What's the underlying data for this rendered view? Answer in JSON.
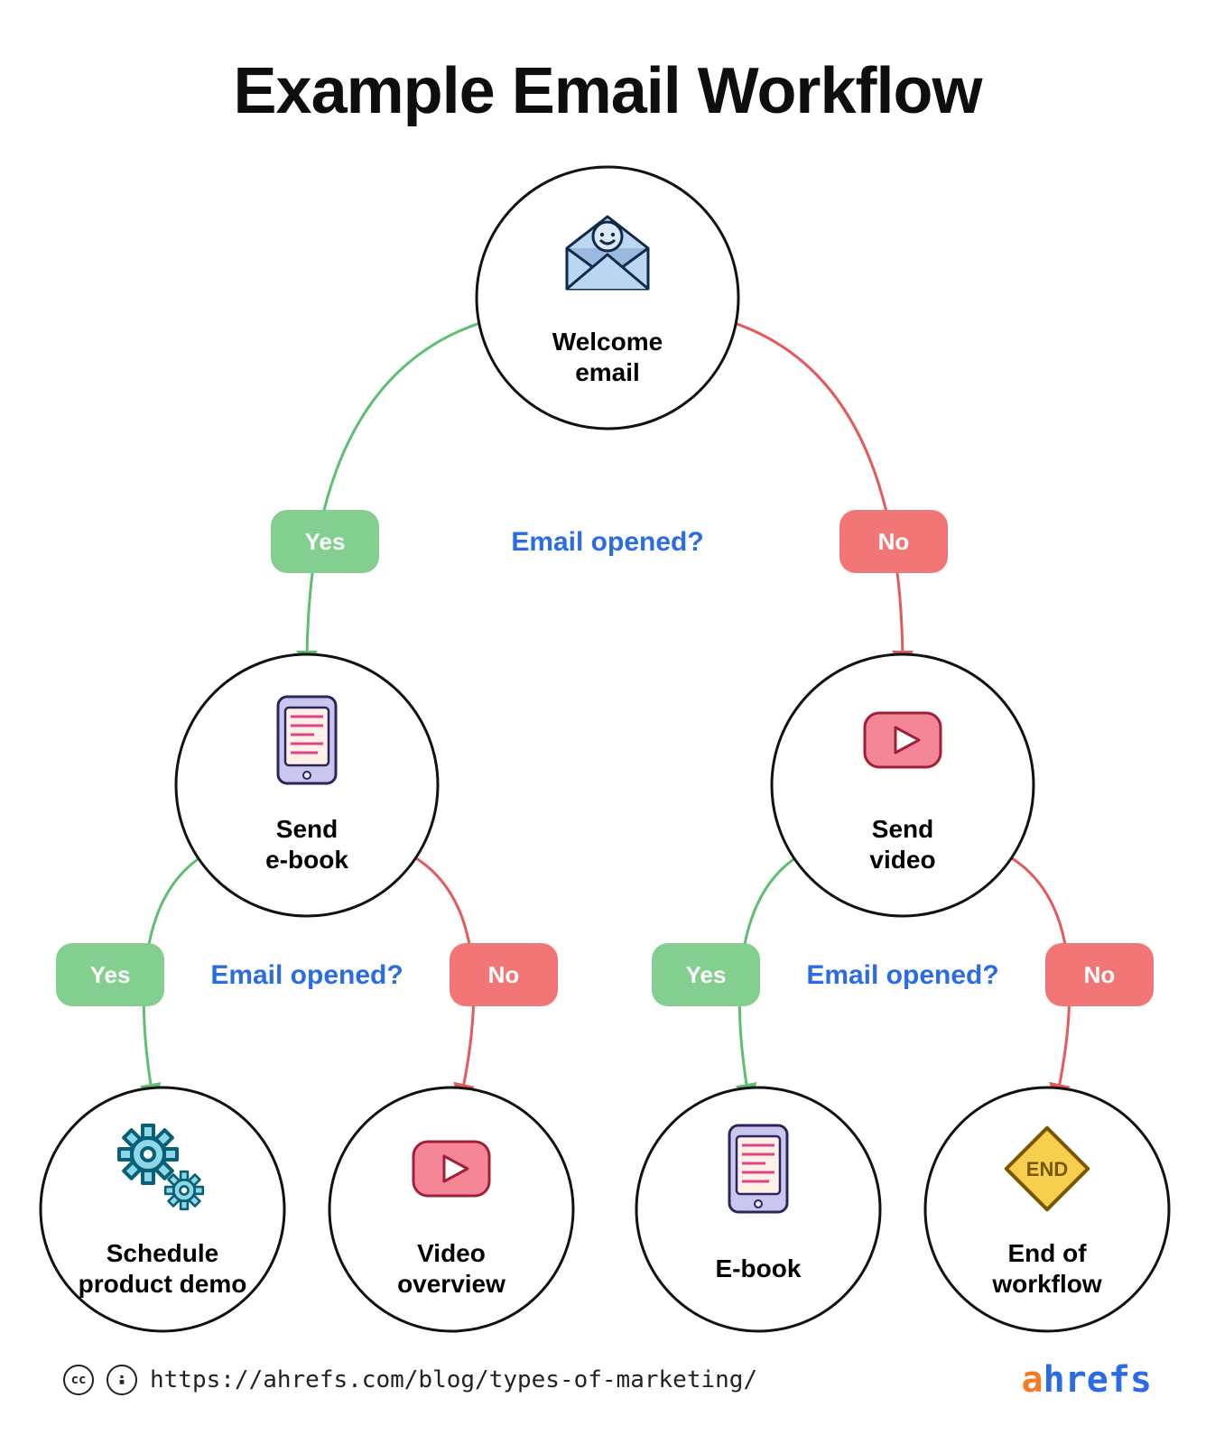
{
  "title": "Example Email Workflow",
  "decision_label": "Email opened?",
  "yes_label": "Yes",
  "no_label": "No",
  "nodes": {
    "root": {
      "label_line1": "Welcome",
      "label_line2": "email",
      "icon": "envelope-smile"
    },
    "l": {
      "label_line1": "Send",
      "label_line2": "e-book",
      "icon": "ebook"
    },
    "r": {
      "label_line1": "Send",
      "label_line2": "video",
      "icon": "video"
    },
    "ll": {
      "label_line1": "Schedule",
      "label_line2": "product demo",
      "icon": "gears"
    },
    "lr": {
      "label_line1": "Video",
      "label_line2": "overview",
      "icon": "video"
    },
    "rl": {
      "label_line1": "E-book",
      "label_line2": "",
      "icon": "ebook"
    },
    "rr": {
      "label_line1": "End of",
      "label_line2": "workflow",
      "icon": "end-sign"
    }
  },
  "colors": {
    "yes": "#82cf8f",
    "no": "#f27676",
    "yes_stroke": "#5fbf70",
    "no_stroke": "#e45a5a",
    "decision": "#2b6be4",
    "node_stroke": "#111"
  },
  "footer": {
    "url": "https://ahrefs.com/blog/types-of-marketing/",
    "brand_first": "a",
    "brand_rest": "hrefs",
    "license_icons": [
      "cc",
      "by"
    ]
  }
}
